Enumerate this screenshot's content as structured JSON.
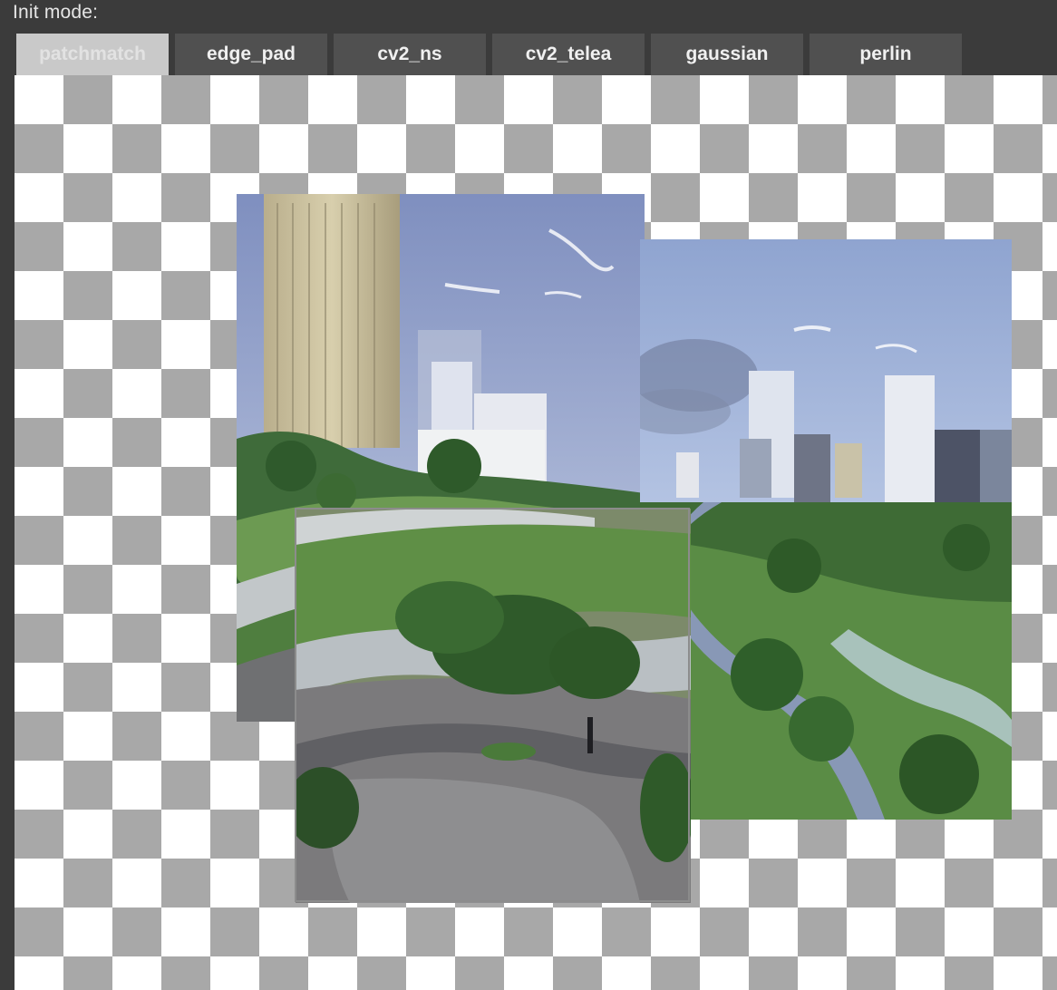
{
  "init_mode": {
    "label": "Init mode:",
    "tabs": [
      {
        "label": "patchmatch",
        "selected": true
      },
      {
        "label": "edge_pad",
        "selected": false
      },
      {
        "label": "cv2_ns",
        "selected": false
      },
      {
        "label": "cv2_telea",
        "selected": false
      },
      {
        "label": "gaussian",
        "selected": false
      },
      {
        "label": "perlin",
        "selected": false
      }
    ]
  },
  "canvas": {
    "background": "transparency-checkerboard",
    "images": [
      "city-park-render-left",
      "city-skyline-river-right",
      "park-plaza-path"
    ],
    "selection": "active-outpaint-region"
  },
  "colors": {
    "panel_bg": "#3b3b3b",
    "tab_bg": "#505050",
    "tab_selected_bg": "#c9c9c9",
    "checker_dark": "#a8a8a8",
    "checker_light": "#ffffff"
  }
}
